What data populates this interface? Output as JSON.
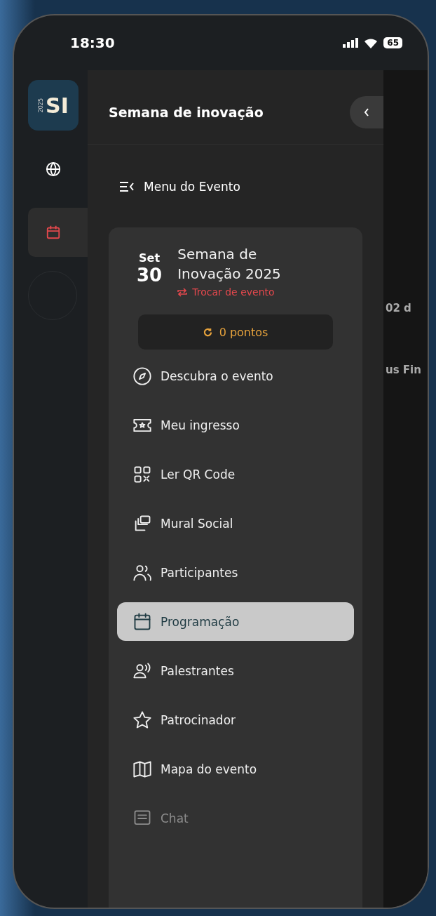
{
  "status_bar": {
    "time": "18:30",
    "battery": "65"
  },
  "rail": {
    "logo_year": "2025",
    "logo_text": "SI",
    "items": [
      {
        "kind": "globe",
        "selected": false
      },
      {
        "kind": "calendar",
        "selected": true
      },
      {
        "kind": "circle",
        "selected": false
      }
    ]
  },
  "drawer": {
    "title": "Semana de inovação",
    "menu_heading": "Menu do Evento",
    "event": {
      "month": "Set",
      "day": "30",
      "name": "Semana de Inovação 2025",
      "switch_link": "Trocar de evento",
      "points": "0 pontos"
    },
    "items": [
      {
        "kind": "compass",
        "label": "Descubra o evento",
        "selected": false
      },
      {
        "kind": "ticket",
        "label": "Meu ingresso",
        "selected": false
      },
      {
        "kind": "qr",
        "label": "Ler QR Code",
        "selected": false
      },
      {
        "kind": "gallery",
        "label": "Mural Social",
        "selected": false
      },
      {
        "kind": "people",
        "label": "Participantes",
        "selected": false
      },
      {
        "kind": "calendar",
        "label": "Programação",
        "selected": true
      },
      {
        "kind": "speaker",
        "label": "Palestrantes",
        "selected": false
      },
      {
        "kind": "star",
        "label": "Patrocinador",
        "selected": false
      },
      {
        "kind": "map",
        "label": "Mapa do evento",
        "selected": false
      },
      {
        "kind": "chat",
        "label": "Chat",
        "selected": false
      }
    ]
  },
  "background": {
    "texts": [
      "02 d",
      "us Fin"
    ]
  }
}
